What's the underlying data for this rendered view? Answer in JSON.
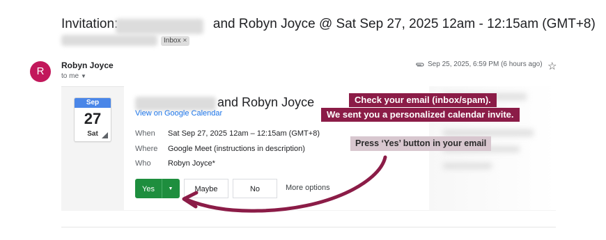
{
  "email": {
    "subject_prefix": "Invitation:",
    "subject_suffix": "and Robyn Joyce @ Sat Sep 27, 2025 12am - 12:15am (GMT+8)",
    "label_chip": "Inbox",
    "label_chip_close": "×",
    "sender_initial": "R",
    "sender_name": "Robyn Joyce",
    "recipient_text": "to me",
    "date_text": "Sep 25, 2025, 6:59 PM (6 hours ago)",
    "star_glyph": "☆"
  },
  "invite": {
    "month": "Sep",
    "day": "27",
    "weekday": "Sat",
    "title_suffix": "and Robyn Joyce",
    "view_link": "View on Google Calendar",
    "details": [
      {
        "label": "When",
        "value": "Sat Sep 27, 2025 12am – 12:15am (GMT+8)"
      },
      {
        "label": "Where",
        "value": "Google Meet (instructions in description)"
      },
      {
        "label": "Who",
        "value": "Robyn Joyce*"
      }
    ],
    "rsvp": {
      "yes": "Yes",
      "dropdown_glyph": "▼",
      "maybe": "Maybe",
      "no": "No",
      "more": "More options"
    }
  },
  "overlay": {
    "banner_line1": "Check your email (inbox/spam).",
    "banner_line2": "We sent you a personalized calendar invite.",
    "tip": "Press ‘Yes’ button in your email",
    "accent_color": "#8b1c47"
  },
  "icons": [
    "attachment-icon",
    "star-icon",
    "calendar-icon",
    "chevron-down-icon",
    "arrow-annotation"
  ]
}
